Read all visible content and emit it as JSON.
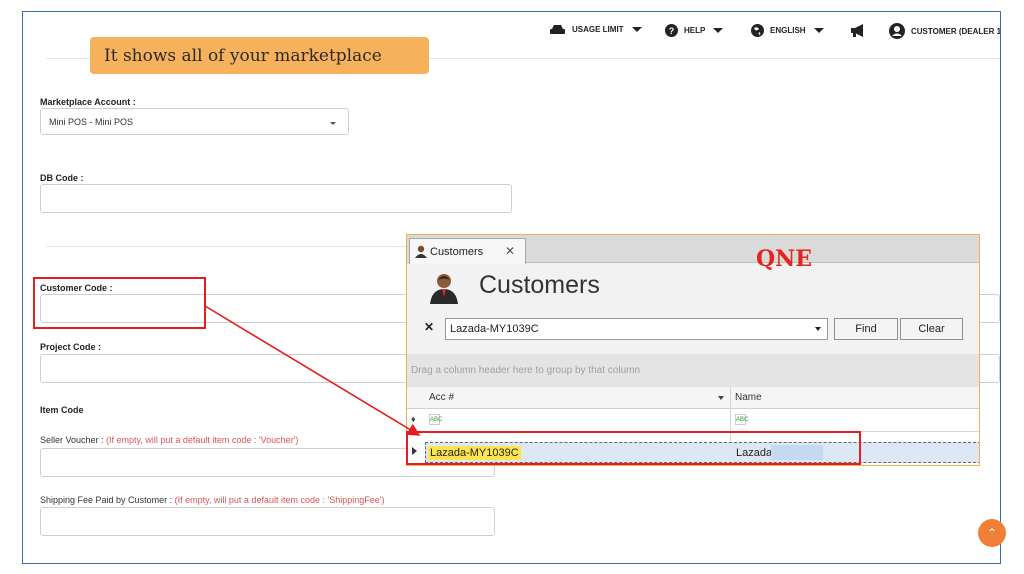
{
  "navbar": {
    "usage_limit": "USAGE LIMIT",
    "help": "HELP",
    "language": "ENGLISH",
    "customer": "CUSTOMER (DEALER 1"
  },
  "callout": {
    "text": "It shows all of your marketplace"
  },
  "form": {
    "marketplace_label": "Marketplace Account :",
    "marketplace_value": "Mini POS - Mini POS",
    "db_code_label": "DB Code :",
    "customer_code_label": "Customer Code :",
    "project_code_label": "Project Code :",
    "item_code_heading": "Item Code",
    "seller_voucher_label": "Seller Voucher : ",
    "seller_voucher_hint": "(If empty, will put a default item code : 'Voucher')",
    "shipping_fee_label": "Shipping Fee Paid by Customer : ",
    "shipping_fee_hint": "(If empty, will put a default item code : 'ShippingFee')"
  },
  "qne": {
    "tab_label": "Customers",
    "title": "Customers",
    "brand": "QNE",
    "search_value": "Lazada-MY1039C",
    "find_button": "Find",
    "clear_button": "Clear",
    "group_hint": "Drag a column header here to group by that column",
    "columns": [
      "Acc #",
      "Name"
    ],
    "selected_row": {
      "acc": "Lazada-MY1039C",
      "name": "Lazada-"
    }
  },
  "colors": {
    "callout": "#f6b15a",
    "annotation_red": "#e81c1c",
    "brand_red": "#e3261d",
    "scroll_button": "#f07f3a"
  },
  "icons": [
    "usage-limit-icon",
    "help-icon",
    "globe-icon",
    "megaphone-icon",
    "user-circle-icon",
    "customer-person-icon",
    "clear-x-icon",
    "chevron-up-icon"
  ]
}
